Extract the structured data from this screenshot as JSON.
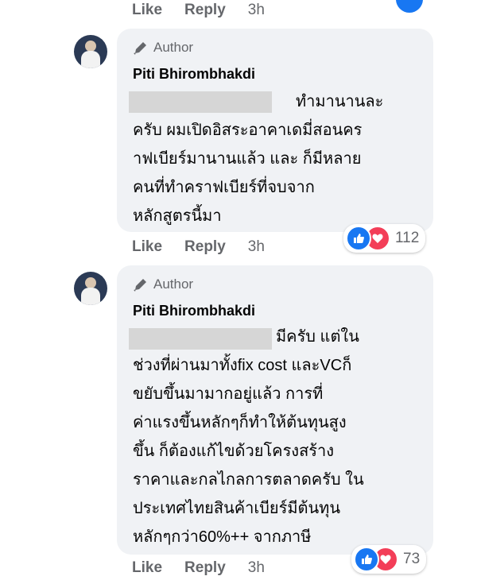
{
  "top_actions": {
    "like": "Like",
    "reply": "Reply",
    "time": "3h"
  },
  "comments": [
    {
      "badge": "Author",
      "name": "Piti Bhirombhakdi",
      "lines": [
        "ทำมานานละ",
        "ครับ ผมเปิดอิสระอาคาเดมี่สอนคร",
        "าฟเบียร์มานานแล้ว และ ก็มีหลาย",
        "คนที่ทำคราฟเบียร์ที่จบจาก",
        "หลักสูตรนี้มา"
      ],
      "reactions": {
        "count": "112",
        "icons": [
          "like-icon",
          "love-icon"
        ]
      },
      "actions": {
        "like": "Like",
        "reply": "Reply",
        "time": "3h"
      }
    },
    {
      "badge": "Author",
      "name": "Piti Bhirombhakdi",
      "lines": [
        "มีครับ แต่ใน",
        "ช่วงที่ผ่านมาทั้งfix cost และVCก็",
        "ขยับขึ้นมามากอยู่แล้ว การที่",
        "ค่าแรงขึ้นหลักๆก็ทำให้ต้นทุนสูง",
        "ขึ้น ก็ต้องแก้ไขด้วยโครงสร้าง",
        "ราคาและกลไกลการตลาดครับ ใน",
        "ประเทศไทยสินค้าเบียร์มีต้นทุน",
        "หลักๆกว่า60%++ จากภาษี"
      ],
      "reactions": {
        "count": "73",
        "icons": [
          "like-icon",
          "love-icon"
        ]
      },
      "actions": {
        "like": "Like",
        "reply": "Reply",
        "time": "3h"
      }
    }
  ],
  "colors": {
    "bubble": "#f0f2f5",
    "meta": "#65676b",
    "like": "#1877f2",
    "love": "#f33e58"
  }
}
